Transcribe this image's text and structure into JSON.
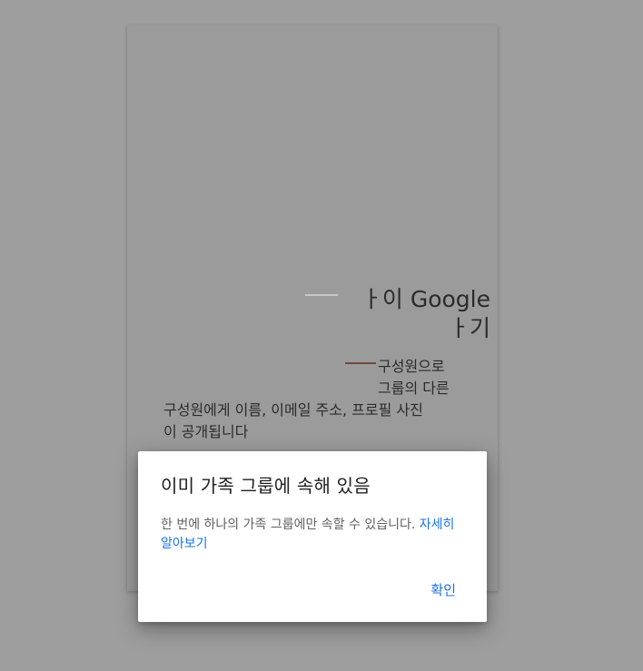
{
  "background_card": {
    "heading_line1_fragment": "ㅏ이 Google",
    "heading_line2_fragment": "ㅏ기",
    "right_line1": "구성원으로",
    "right_line2": "그룹의 다른",
    "body_line1": "구성원에게 이름, 이메일 주소, 프로필 사진",
    "body_line2": "이 공개됩니다"
  },
  "dialog": {
    "title": "이미 가족 그룹에 속해 있음",
    "message": "한 번에 하나의 가족 그룹에만 속할 수 있습니다.",
    "learn_more_label": "자세히 알아보기",
    "ok_label": "확인"
  },
  "colors": {
    "scrim": "#9e9e9e",
    "accent": "#1a73e8",
    "dialog_bg": "#ffffff"
  }
}
